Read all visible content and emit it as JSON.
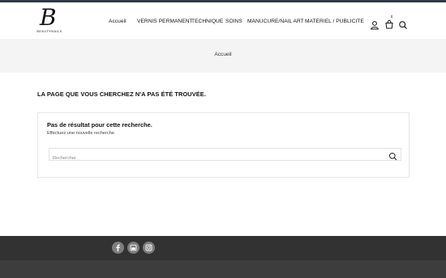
{
  "brand": {
    "logo_letter": "B",
    "logo_text": "BEAUTYNAILS"
  },
  "nav": {
    "items": [
      {
        "label": "Accueil"
      },
      {
        "label": "VERNIS PERMANENT"
      },
      {
        "label": "TECHNIQUE"
      },
      {
        "label": "SOINS"
      },
      {
        "label": "MANUCURE/NAIL ART"
      },
      {
        "label": "MATERIEL / PUBLICITE"
      }
    ],
    "cart_count": "0",
    "icons": [
      "user-icon",
      "cart-icon",
      "search-icon"
    ]
  },
  "breadcrumb": {
    "current": "Accueil"
  },
  "main": {
    "not_found_title": "LA PAGE QUE VOUS CHERCHEZ N'A PAS ÉTÉ TROUVÉE.",
    "no_result_title": "Pas de résultat pour cette recherche.",
    "no_result_subtitle": "Effectuez une nouvelle recherche",
    "search_placeholder": "Rechercher"
  },
  "footer": {
    "social": [
      "facebook-icon",
      "youtube-icon",
      "instagram-icon"
    ]
  },
  "colors": {
    "topbar": "#2f3a45",
    "breadcrumb_band": "#f4f4f4",
    "footer_top": "#323232",
    "footer_bottom": "#3d3d3d",
    "social_circle": "#7e7e7e"
  }
}
